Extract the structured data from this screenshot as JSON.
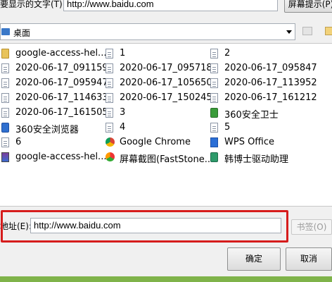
{
  "top_bar": {
    "label": "要显示的文字(T):",
    "value": "http://www.baidu.com",
    "tip_button": "屏幕提示(P)"
  },
  "look_in": {
    "value": "桌面"
  },
  "files": [
    {
      "label": "google-access-hel...",
      "icon": "folder-icon"
    },
    {
      "label": "1",
      "icon": "file-icon"
    },
    {
      "label": "2",
      "icon": "file-icon"
    },
    {
      "label": "2020-06-17_091159",
      "icon": "file-icon"
    },
    {
      "label": "2020-06-17_095718",
      "icon": "file-icon"
    },
    {
      "label": "2020-06-17_095847",
      "icon": "file-icon"
    },
    {
      "label": "2020-06-17_095947",
      "icon": "file-icon"
    },
    {
      "label": "2020-06-17_105650",
      "icon": "file-icon"
    },
    {
      "label": "2020-06-17_113952",
      "icon": "file-icon"
    },
    {
      "label": "2020-06-17_114633",
      "icon": "file-icon"
    },
    {
      "label": "2020-06-17_150245",
      "icon": "file-icon"
    },
    {
      "label": "2020-06-17_161212",
      "icon": "file-icon"
    },
    {
      "label": "2020-06-17_161505",
      "icon": "file-icon"
    },
    {
      "label": "3",
      "icon": "file-icon"
    },
    {
      "label": "360安全卫士",
      "icon": "app-icon"
    },
    {
      "label": "360安全浏览器",
      "icon": "app-icon"
    },
    {
      "label": "4",
      "icon": "file-icon"
    },
    {
      "label": "5",
      "icon": "file-icon"
    },
    {
      "label": "6",
      "icon": "file-icon"
    },
    {
      "label": "Google Chrome",
      "icon": "chrome-icon"
    },
    {
      "label": "WPS Office",
      "icon": "wps-icon"
    },
    {
      "label": "google-access-hel...",
      "icon": "archive-icon"
    },
    {
      "label": "屏幕截图(FastStone...",
      "icon": "screenshot-app-icon"
    },
    {
      "label": "韩博士驱动助理",
      "icon": "app-icon"
    }
  ],
  "address": {
    "label": "地址(E):",
    "value": "http://www.baidu.com"
  },
  "buttons": {
    "bookmark": "书签(O)",
    "ok": "确定",
    "cancel": "取消"
  }
}
